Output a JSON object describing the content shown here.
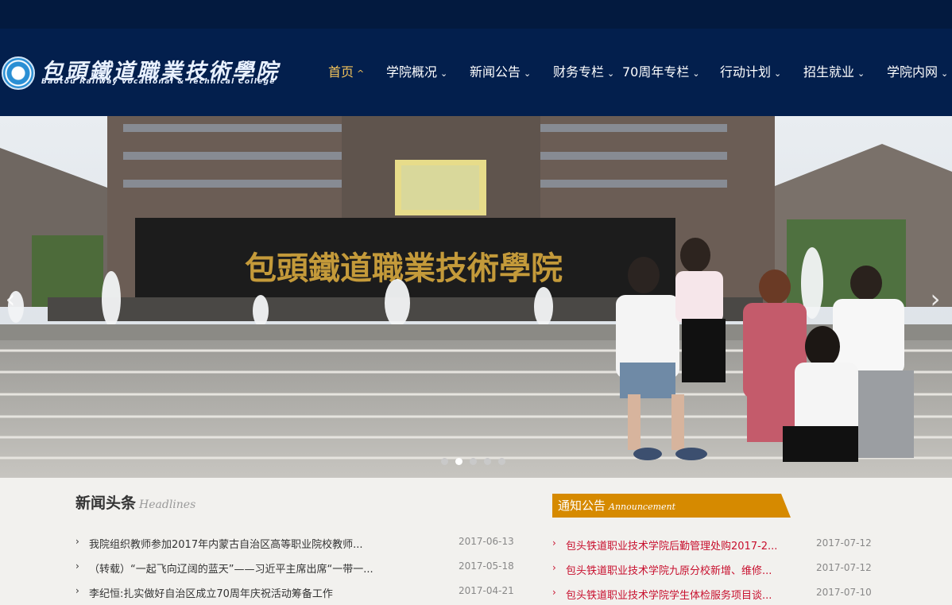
{
  "logo": {
    "name_cn": "包頭鐵道職業技術學院",
    "name_en": "Baotou Railway Vocational & Technical College"
  },
  "nav": [
    {
      "label": "首页",
      "active": true,
      "chevron": "^"
    },
    {
      "label": "学院概况",
      "chevron": "⌄"
    },
    {
      "label": "新闻公告",
      "chevron": "⌄"
    },
    {
      "label": "财务专栏",
      "chevron": "⌄"
    },
    {
      "label": "70周年专栏",
      "chevron": "⌄"
    },
    {
      "label": "行动计划",
      "chevron": "⌄"
    },
    {
      "label": "招生就业",
      "chevron": "⌄"
    },
    {
      "label": "学院内网",
      "chevron": "⌄"
    }
  ],
  "hero": {
    "wall_text": "包頭鐵道職業技術學院",
    "prev_arrow": "‹",
    "next_arrow": "›",
    "slide_count": 5,
    "active_slide": 2
  },
  "news": {
    "title": "新闻头条",
    "subtitle": "Headlines",
    "bullet": "›",
    "items": [
      {
        "text": "我院组织教师参加2017年内蒙古自治区高等职业院校教师...",
        "date": "2017-06-13"
      },
      {
        "text": "（转载）“一起飞向辽阔的蓝天”——习近平主席出席“一带一...",
        "date": "2017-05-18"
      },
      {
        "text": "李纪恒:扎实做好自治区成立70周年庆祝活动筹备工作",
        "date": "2017-04-21"
      }
    ]
  },
  "notice": {
    "title": "通知公告",
    "subtitle": "Announcement",
    "bullet": "›",
    "items": [
      {
        "text": "包头铁道职业技术学院后勤管理处购2017-2...",
        "date": "2017-07-12"
      },
      {
        "text": "包头铁道职业技术学院九原分校新增、维修...",
        "date": "2017-07-12"
      },
      {
        "text": "包头铁道职业技术学院学生体检服务项目谈...",
        "date": "2017-07-10"
      }
    ]
  },
  "colors": {
    "header_bg": "#031f4d",
    "nav_active": "#f3c35a",
    "notice_accent": "#d68a00",
    "notice_link": "#c8102e"
  }
}
